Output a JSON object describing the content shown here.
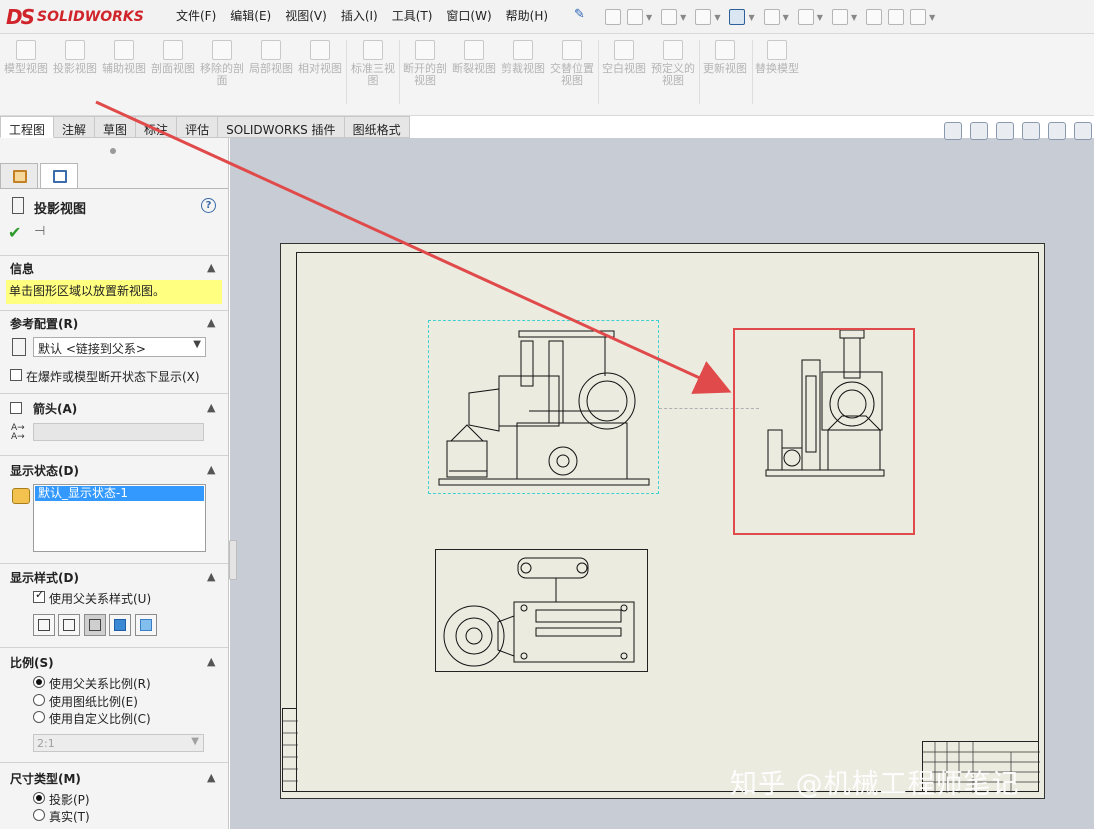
{
  "app": {
    "logo_ds": "DS",
    "logo_text": "SOLIDWORKS",
    "menus": [
      "文件(F)",
      "编辑(E)",
      "视图(V)",
      "插入(I)",
      "工具(T)",
      "窗口(W)",
      "帮助(H)"
    ]
  },
  "ribbon": {
    "buttons": [
      "模型视图",
      "投影视图",
      "辅助视图",
      "剖面视图",
      "移除的剖面",
      "局部视图",
      "相对视图",
      "标准三视图",
      "断开的剖视图",
      "断裂视图",
      "剪裁视图",
      "交替位置视图",
      "空白视图",
      "预定义的视图",
      "更新视图",
      "替换模型"
    ]
  },
  "tabs": [
    "工程图",
    "注解",
    "草图",
    "标注",
    "评估",
    "SOLIDWORKS 插件",
    "图纸格式"
  ],
  "active_tab": "工程图",
  "property_manager": {
    "title": "投影视图",
    "help": "?",
    "info": {
      "heading": "信息",
      "message": "单击图形区域以放置新视图。"
    },
    "reference_config": {
      "heading": "参考配置(R)",
      "value": "默认 <链接到父系>",
      "checkbox_label": "在爆炸或模型断开状态下显示(X)",
      "checked": false
    },
    "arrow": {
      "heading": "箭头(A)",
      "checked": false
    },
    "display_state": {
      "heading": "显示状态(D)",
      "selected": "默认_显示状态-1"
    },
    "display_style": {
      "heading": "显示样式(D)",
      "checkbox_label": "使用父关系样式(U)",
      "checked": true
    },
    "scale": {
      "heading": "比例(S)",
      "options": [
        "使用父关系比例(R)",
        "使用图纸比例(E)",
        "使用自定义比例(C)"
      ],
      "selected_index": 0,
      "custom_value": "2:1"
    },
    "dimension_type": {
      "heading": "尺寸类型(M)",
      "options": [
        "投影(P)",
        "真实(T)"
      ],
      "selected_index": 0
    }
  },
  "colors": {
    "highlight_box": "#e04a4a",
    "arrow": "#e04a4a",
    "selection_blue": "#3399ff",
    "info_yellow": "#ffff80",
    "brand_red": "#d0242b"
  },
  "watermark": "知乎 @机械工程师笔记"
}
